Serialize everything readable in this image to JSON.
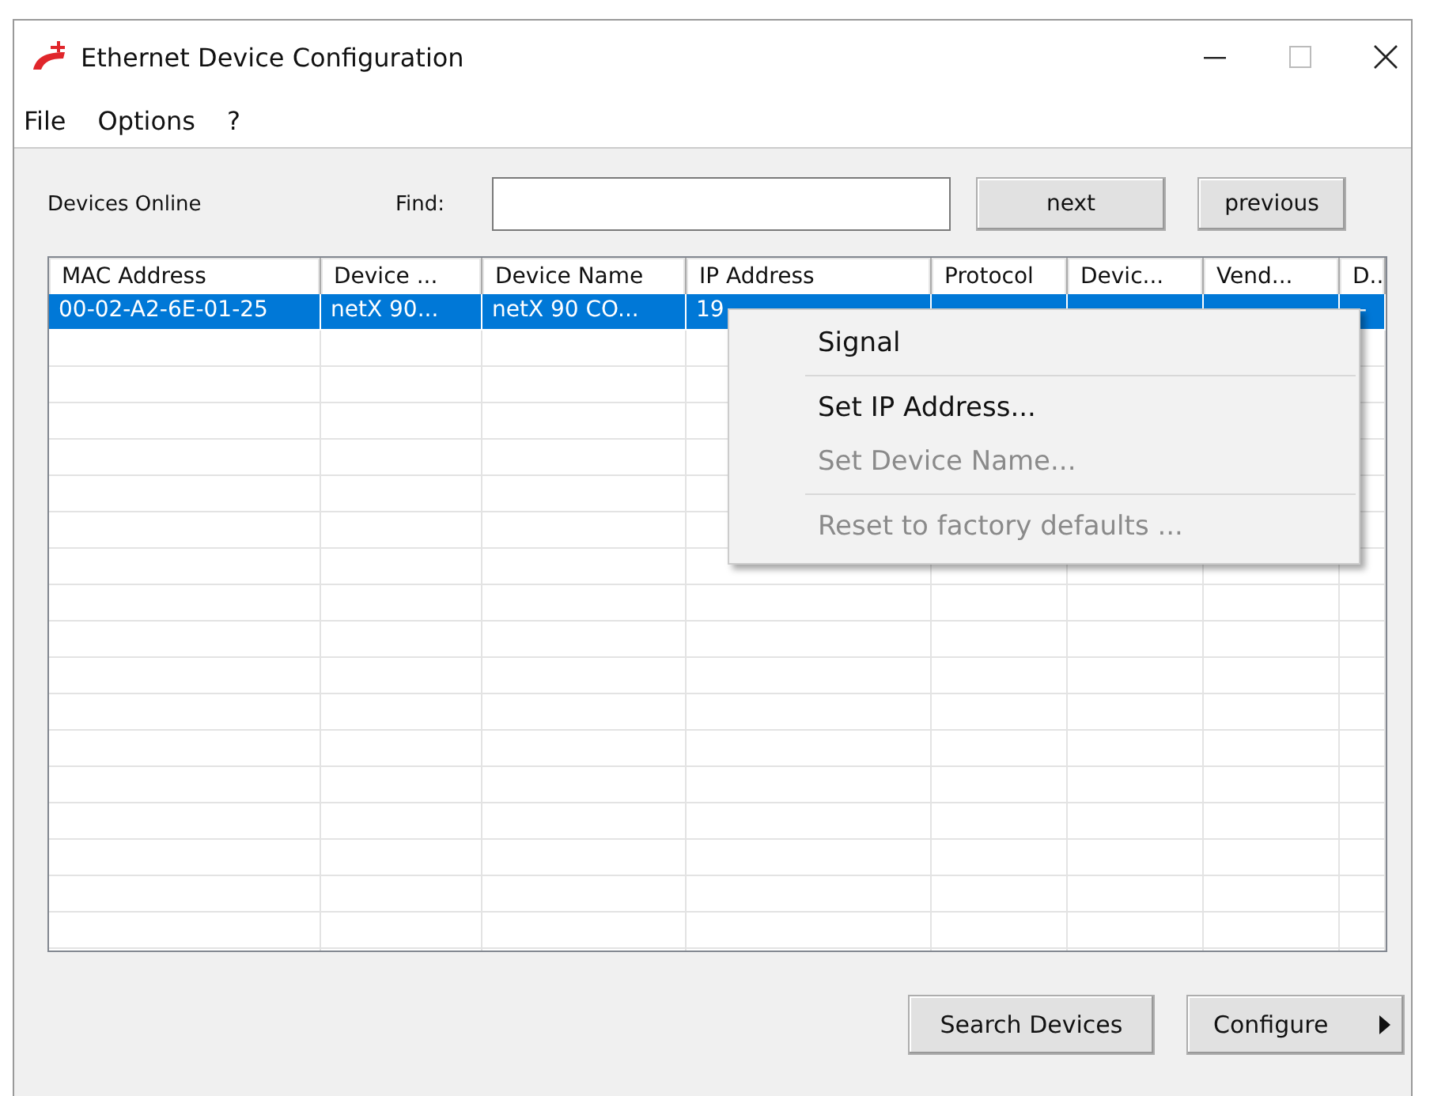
{
  "window": {
    "title": "Ethernet Device Configuration"
  },
  "menu": [
    "File",
    "Options",
    "?"
  ],
  "find_bar": {
    "label": "Devices Online",
    "find_label": "Find:",
    "buttons": [
      "next",
      "previous"
    ]
  },
  "table": {
    "columns": [
      "MAC Address",
      "Device ...",
      "Device Name",
      "IP Address",
      "Protocol",
      "Devic...",
      "Vend...",
      "D..."
    ],
    "rows": [
      {
        "selected": true,
        "cells": [
          "00-02-A2-6E-01-25",
          "netX 90...",
          "netX 90 CO...",
          "19",
          "",
          "",
          "",
          "-"
        ]
      }
    ]
  },
  "context_menu": {
    "items": [
      {
        "kind": "item",
        "label": "Signal",
        "disabled": false
      },
      {
        "kind": "separator"
      },
      {
        "kind": "item",
        "label": "Set IP Address...",
        "disabled": false
      },
      {
        "kind": "item",
        "label": "Set Device Name...",
        "disabled": true
      },
      {
        "kind": "separator"
      },
      {
        "kind": "item",
        "label": "Reset to factory defaults ...",
        "disabled": true
      }
    ]
  },
  "buttons": [
    {
      "kind": "plain",
      "label": "Search Devices"
    },
    {
      "kind": "split",
      "label": "Configure"
    }
  ]
}
